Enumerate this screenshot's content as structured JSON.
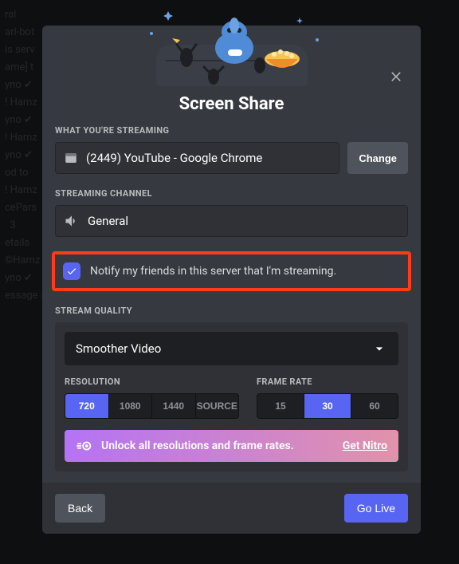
{
  "background": {
    "lines": [
      "ral",
      "arl-bot",
      "is serv                                                    erole c",
      "ame] t",
      "",
      "yno ✔",
      "",
      "",
      "",
      "! Hamz",
      "yno ✔",
      "",
      "",
      "! Hamz",
      "yno ✔",
      "",
      "",
      "od to",
      "",
      "! Hamz",
      "cePars",
      "  3",
      "etails",
      "",
      "",
      "©Hamz",
      "yno ✔",
      "",
      "essage #general"
    ]
  },
  "modal": {
    "title": "Screen Share",
    "section_streaming_label": "WHAT YOU'RE STREAMING",
    "streaming_source": "(2449) YouTube - Google Chrome",
    "change_label": "Change",
    "section_channel_label": "STREAMING CHANNEL",
    "channel_name": "General",
    "notify_label": "Notify my friends in this server that I'm streaming.",
    "section_quality_label": "STREAM QUALITY",
    "quality_select": "Smoother Video",
    "resolution_label": "RESOLUTION",
    "resolutions": [
      "720",
      "1080",
      "1440",
      "SOURCE"
    ],
    "resolution_active": "720",
    "framerate_label": "FRAME RATE",
    "framerates": [
      "15",
      "30",
      "60"
    ],
    "framerate_active": "30",
    "nitro_text": "Unlock all resolutions and frame rates.",
    "nitro_cta": "Get Nitro",
    "back_label": "Back",
    "golive_label": "Go Live"
  },
  "colors": {
    "blurple": "#5865f2",
    "highlight": "#ff3c1a"
  }
}
